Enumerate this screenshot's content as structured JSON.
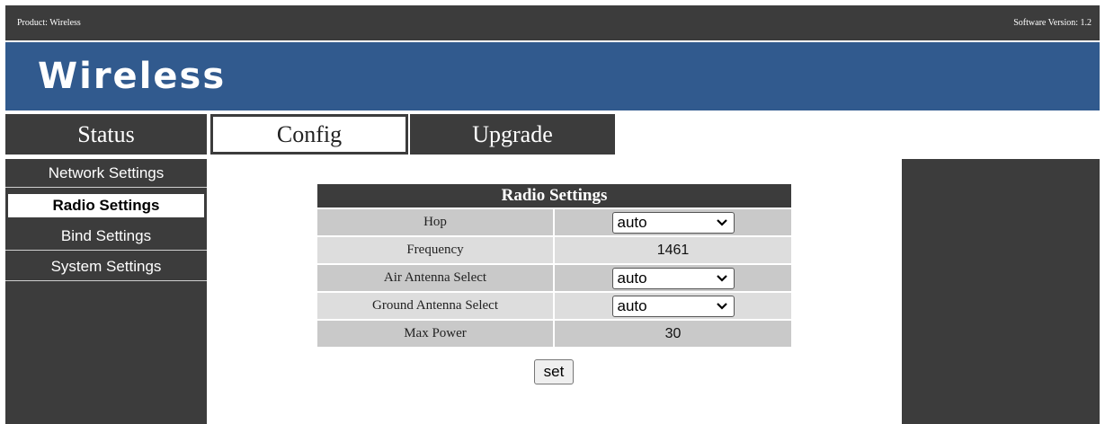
{
  "topbar": {
    "product": "Product: Wireless",
    "version": "Software Version: 1.2"
  },
  "banner": {
    "logo": "Wireless"
  },
  "tabs": [
    {
      "label": "Status",
      "active": false
    },
    {
      "label": "Config",
      "active": true
    },
    {
      "label": "Upgrade",
      "active": false
    }
  ],
  "sidebar": {
    "items": [
      {
        "label": "Network Settings",
        "active": false
      },
      {
        "label": "Radio Settings",
        "active": true
      },
      {
        "label": "Bind Settings",
        "active": false
      },
      {
        "label": "System Settings",
        "active": false
      }
    ]
  },
  "radio_settings": {
    "title": "Radio Settings",
    "rows": [
      {
        "label": "Hop",
        "value": "auto",
        "control": "select"
      },
      {
        "label": "Frequency",
        "value": "1461",
        "control": "text"
      },
      {
        "label": "Air Antenna Select",
        "value": "auto",
        "control": "select"
      },
      {
        "label": "Ground Antenna Select",
        "value": "auto",
        "control": "select"
      },
      {
        "label": "Max Power",
        "value": "30",
        "control": "text"
      }
    ],
    "set_label": "set"
  },
  "colors": {
    "dark": "#3c3c3c",
    "banner": "#315a8e",
    "row_light": "#dddddd",
    "row_dark": "#c9c9c9"
  },
  "icons": {
    "dropdown": "chevron-down-icon"
  }
}
